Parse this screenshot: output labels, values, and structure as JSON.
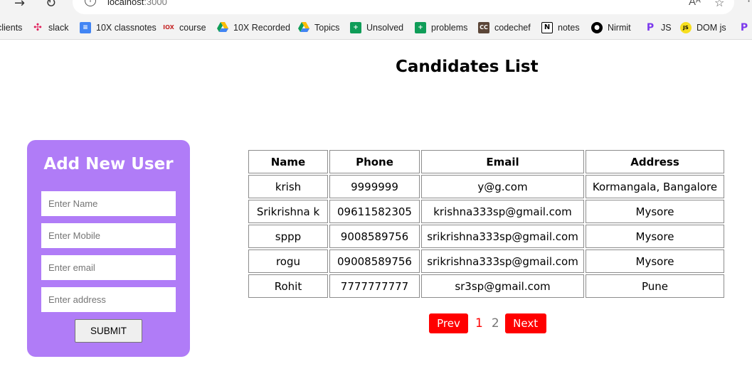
{
  "browser": {
    "url_host": "localhost",
    "url_port": ":3000",
    "bookmarks": [
      {
        "label": "clients",
        "icon": "none"
      },
      {
        "label": "slack",
        "icon": "slack-icon",
        "color": "#e01e5a"
      },
      {
        "label": "10X classnotes",
        "icon": "docs-icon",
        "color": "#4285f4"
      },
      {
        "label": "course",
        "icon": "10x-icon",
        "color": "#c62828"
      },
      {
        "label": "10X Recorded",
        "icon": "drive-icon",
        "color": "#fbbc04"
      },
      {
        "label": "Topics",
        "icon": "drive-icon",
        "color": "#fbbc04"
      },
      {
        "label": "Unsolved",
        "icon": "sheets-icon",
        "color": "#0f9d58"
      },
      {
        "label": "problems",
        "icon": "sheets-icon",
        "color": "#0f9d58"
      },
      {
        "label": "codechef",
        "icon": "codechef-icon",
        "color": "#5b4638"
      },
      {
        "label": "notes",
        "icon": "notion-icon",
        "color": "#000000"
      },
      {
        "label": "Nirmit",
        "icon": "github-icon",
        "color": "#000000"
      },
      {
        "label": "JS",
        "icon": "p-icon",
        "color": "#7c3aed"
      },
      {
        "label": "DOM js",
        "icon": "js-icon",
        "color": "#f7df1e"
      }
    ]
  },
  "page": {
    "title": "Candidates List"
  },
  "form": {
    "title": "Add New User",
    "name_placeholder": "Enter Name",
    "mobile_placeholder": "Enter Mobile",
    "email_placeholder": "Enter email",
    "address_placeholder": "Enter address",
    "submit_label": "SUBMIT",
    "background": "#b07cf7"
  },
  "table": {
    "headers": [
      "Name",
      "Phone",
      "Email",
      "Address"
    ],
    "rows": [
      [
        "krish",
        "9999999",
        "y@g.com",
        "Kormangala, Bangalore"
      ],
      [
        "Srikrishna k",
        "09611582305",
        "krishna333sp@gmail.com",
        "Mysore"
      ],
      [
        "sppp",
        "9008589756",
        "srikrishna333sp@gmail.com",
        "Mysore"
      ],
      [
        "rogu",
        "09008589756",
        "srikrishna333sp@gmail.com",
        "Mysore"
      ],
      [
        "Rohit",
        "7777777777",
        "sr3sp@gmail.com",
        "Pune"
      ]
    ]
  },
  "pagination": {
    "prev_label": "Prev",
    "pages": [
      "1",
      "2"
    ],
    "current_page": "1",
    "next_label": "Next",
    "button_color": "#ff0000"
  }
}
